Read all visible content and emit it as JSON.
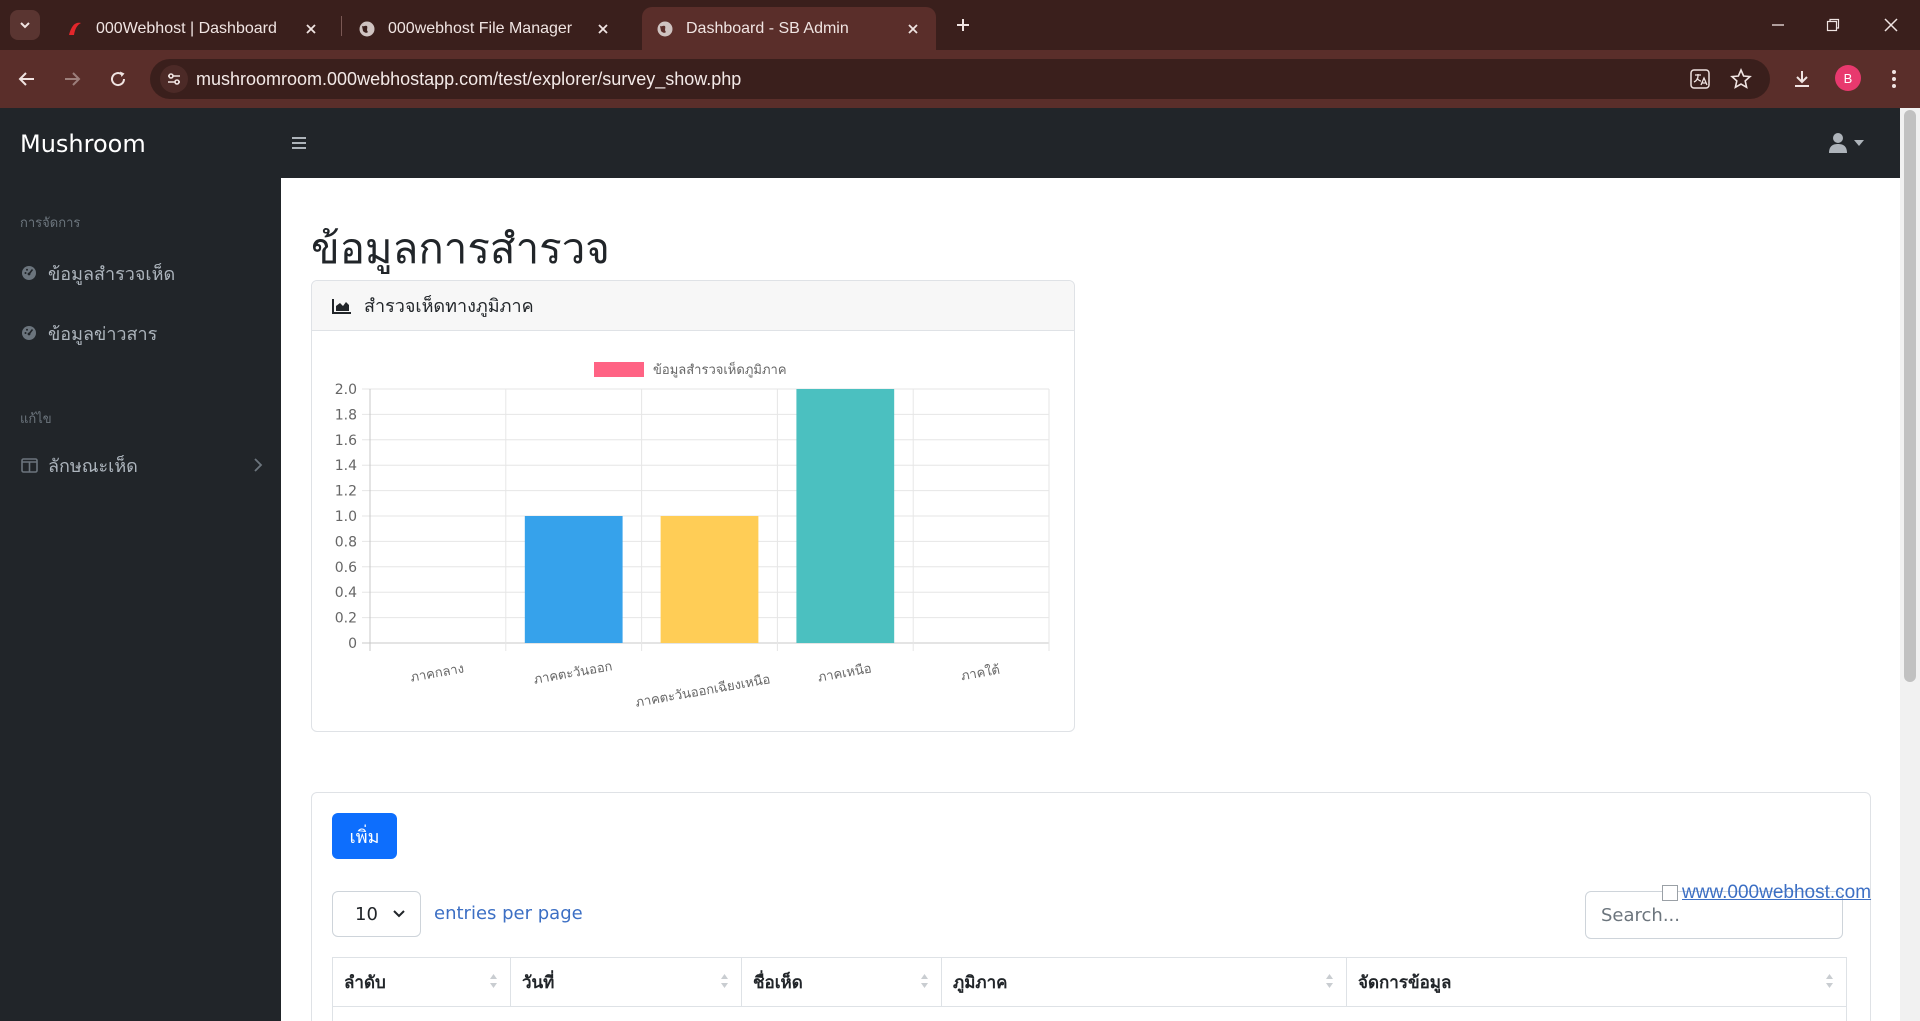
{
  "browser": {
    "tabs": [
      {
        "title": "000Webhost | Dashboard",
        "icon": "webhost-logo-icon",
        "active": false
      },
      {
        "title": "000webhost File Manager",
        "icon": "globe-icon",
        "active": false
      },
      {
        "title": "Dashboard - SB Admin",
        "icon": "globe-icon",
        "active": true
      }
    ],
    "url": "mushroomroom.000webhostapp.com/test/explorer/survey_show.php",
    "profile_initial": "B"
  },
  "app": {
    "brand": "Mushroom",
    "sidebar": {
      "sections": [
        {
          "heading": "การจัดการ",
          "items": [
            {
              "label": "ข้อมูลสำรวจเห็ด",
              "icon": "tachometer-icon"
            },
            {
              "label": "ข้อมูลข่าวสาร",
              "icon": "tachometer-icon"
            }
          ]
        },
        {
          "heading": "แก้ไข",
          "items": [
            {
              "label": "ลักษณะเห็ด",
              "icon": "columns-icon",
              "expandable": true
            }
          ]
        }
      ]
    }
  },
  "main": {
    "page_title": "ข้อมูลการสำรวจ",
    "chart_card": {
      "header": "สำรวจเห็ดทางภูมิภาค",
      "icon": "area-chart-icon"
    },
    "table": {
      "add_button": "เพิ่ม",
      "per_page_value": "10",
      "per_page_label": "entries per page",
      "search_placeholder": "Search...",
      "columns": [
        "ลำดับ",
        "วันที่",
        "ชื่อเห็ด",
        "ภูมิภาค",
        "จัดการข้อมูล"
      ]
    },
    "host_badge": "www.000webhost.com"
  },
  "chart_data": {
    "type": "bar",
    "categories": [
      "ภาคกลาง",
      "ภาคตะวันออก",
      "ภาคตะวันออกเฉียงเหนือ",
      "ภาคเหนือ",
      "ภาคใต้"
    ],
    "series": [
      {
        "name": "ข้อมูลสำรวจเห็ดภูมิภาค",
        "values": [
          0,
          1,
          1,
          2,
          0
        ]
      }
    ],
    "bar_colors": [
      "#ff6384",
      "#36a2eb",
      "#ffcd56",
      "#4bc0c0",
      "#9966ff"
    ],
    "legend_color": "#ff6384",
    "ylim": [
      0,
      2
    ],
    "yticks": [
      "0",
      "0.2",
      "0.4",
      "0.6",
      "0.8",
      "1.0",
      "1.2",
      "1.4",
      "1.6",
      "1.8",
      "2.0"
    ],
    "grid": true,
    "legend": "top"
  }
}
